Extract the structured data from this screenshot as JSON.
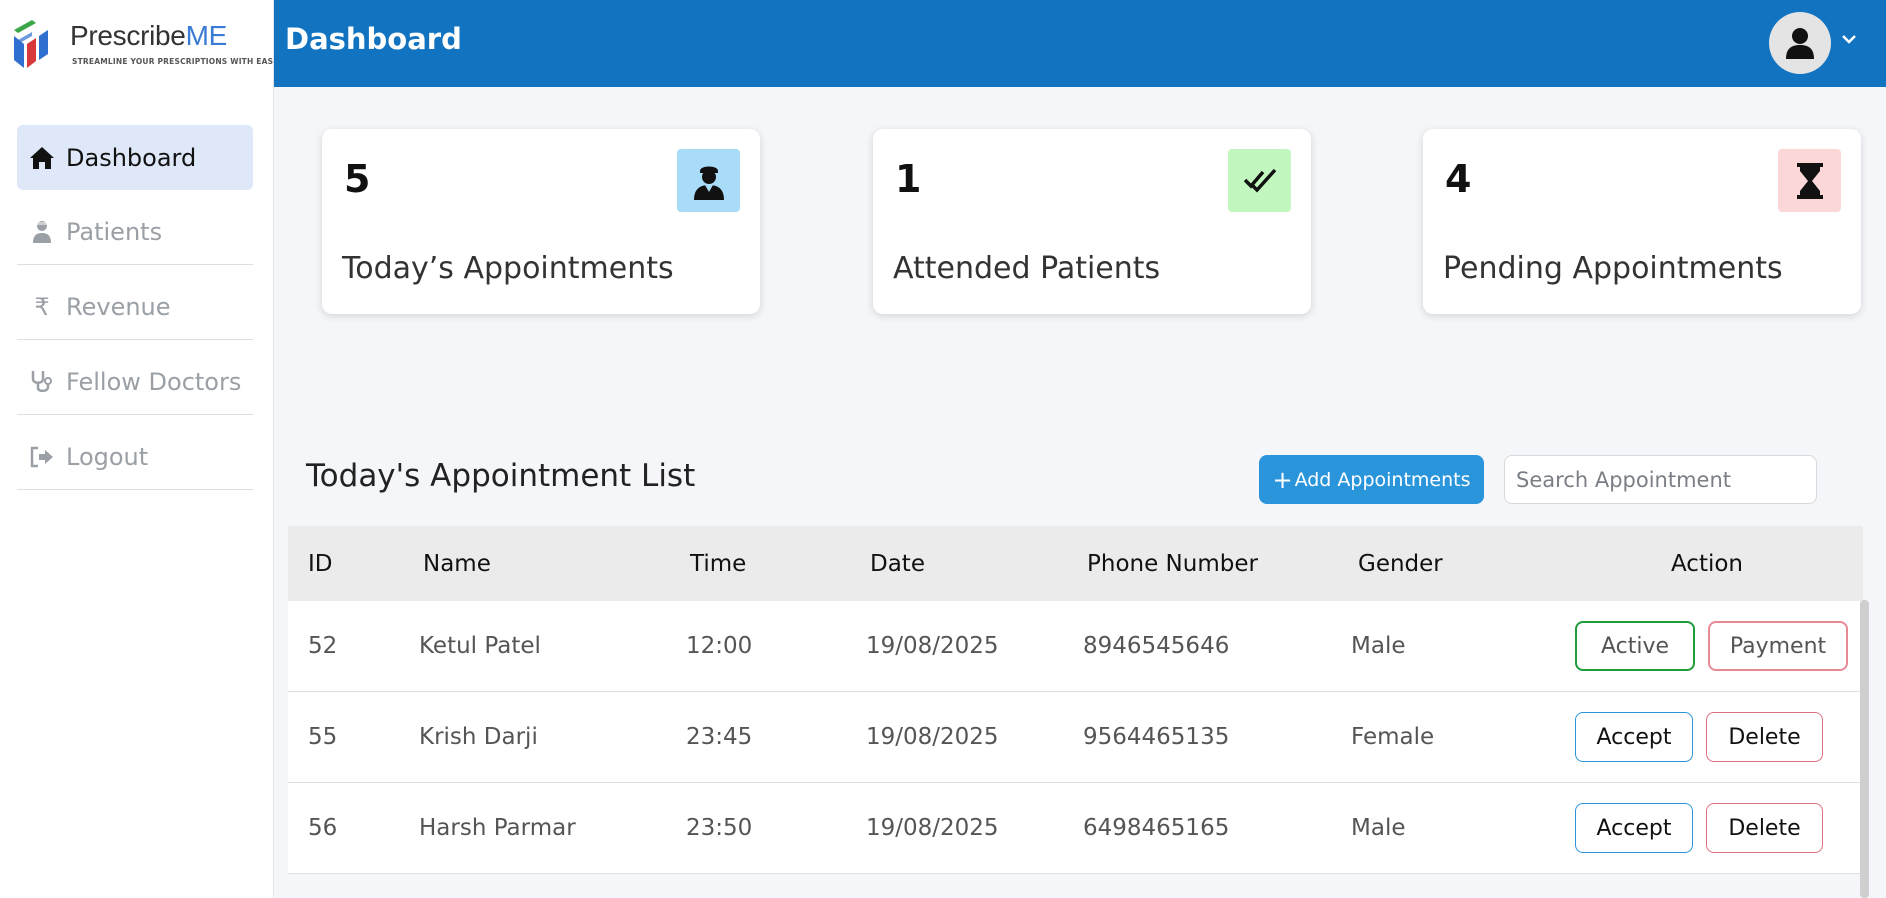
{
  "brand": {
    "name_part1": "Prescribe",
    "name_part2": "ME",
    "tagline": "STREAMLINE YOUR PRESCRIPTIONS WITH EASE"
  },
  "sidebar": {
    "items": [
      {
        "label": "Dashboard",
        "icon": "home-icon",
        "active": true
      },
      {
        "label": "Patients",
        "icon": "patient-icon",
        "active": false
      },
      {
        "label": "Revenue",
        "icon": "rupee-icon",
        "active": false
      },
      {
        "label": "Fellow Doctors",
        "icon": "stethoscope-icon",
        "active": false
      },
      {
        "label": "Logout",
        "icon": "logout-icon",
        "active": false
      }
    ]
  },
  "header": {
    "title": "Dashboard"
  },
  "stats": [
    {
      "value": "5",
      "label": "Today’s Appointments",
      "icon": "doctor-icon",
      "color": "#a9dcf8"
    },
    {
      "value": "1",
      "label": "Attended Patients",
      "icon": "double-check-icon",
      "color": "#c2f7c0"
    },
    {
      "value": "4",
      "label": "Pending Appointments",
      "icon": "hourglass-icon",
      "color": "#fcd7d7"
    }
  ],
  "list": {
    "title": "Today's Appointment List",
    "add_label": "Add Appointments",
    "search_placeholder": "Search Appointment"
  },
  "table": {
    "headers": [
      "ID",
      "Name",
      "Time",
      "Date",
      "Phone Number",
      "Gender",
      "Action"
    ],
    "rows": [
      {
        "id": "52",
        "name": "Ketul Patel",
        "time": "12:00",
        "date": "19/08/2025",
        "phone": "8946545646",
        "gender": "Male",
        "actions": [
          "Active",
          "Payment"
        ]
      },
      {
        "id": "55",
        "name": "Krish Darji",
        "time": "23:45",
        "date": "19/08/2025",
        "phone": "9564465135",
        "gender": "Female",
        "actions": [
          "Accept",
          "Delete"
        ]
      },
      {
        "id": "56",
        "name": "Harsh Parmar",
        "time": "23:50",
        "date": "19/08/2025",
        "phone": "6498465165",
        "gender": "Male",
        "actions": [
          "Accept",
          "Delete"
        ]
      }
    ]
  },
  "colors": {
    "header": "#1274c0",
    "accent": "#2b95dc",
    "active_nav": "#dfe8f8"
  }
}
